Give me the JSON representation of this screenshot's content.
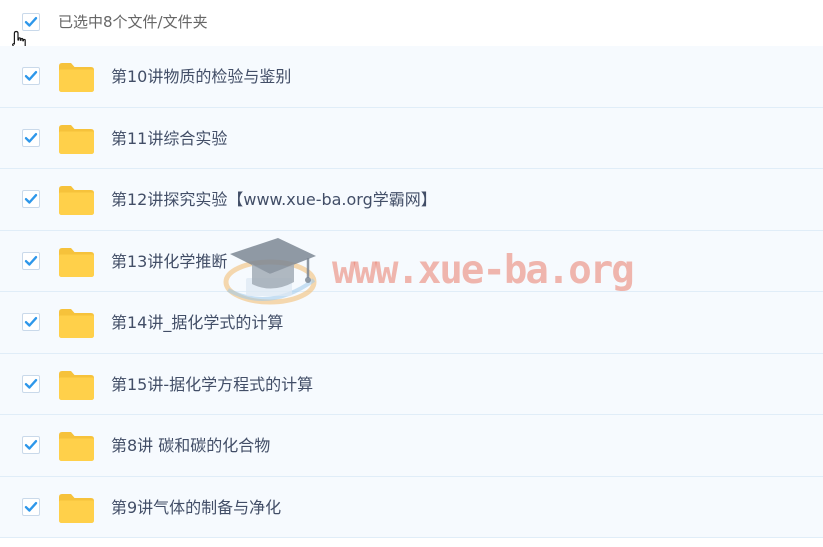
{
  "selection": {
    "checked": true,
    "summary": "已选中8个文件/文件夹"
  },
  "icons": {
    "checkbox": "check-icon",
    "folder": "folder-icon",
    "cursor": "hand-pointer-icon",
    "watermark": "graduation-cap-icon"
  },
  "colors": {
    "check": "#2d97ea",
    "folder": "#ffd04a",
    "folder_tab": "#f6c23b",
    "row_bg": "#f6fafe",
    "watermark": "#ea7c6a"
  },
  "files": [
    {
      "name": "第10讲物质的检验与鉴别",
      "checked": true
    },
    {
      "name": "第11讲综合实验",
      "checked": true
    },
    {
      "name": "第12讲探究实验【www.xue-ba.org学霸网】",
      "checked": true
    },
    {
      "name": "第13讲化学推断",
      "checked": true
    },
    {
      "name": "第14讲_据化学式的计算",
      "checked": true
    },
    {
      "name": "第15讲-据化学方程式的计算",
      "checked": true
    },
    {
      "name": "第8讲 碳和碳的化合物",
      "checked": true
    },
    {
      "name": "第9讲气体的制备与净化",
      "checked": true
    }
  ],
  "watermark": {
    "text": "www.xue-ba.org"
  }
}
